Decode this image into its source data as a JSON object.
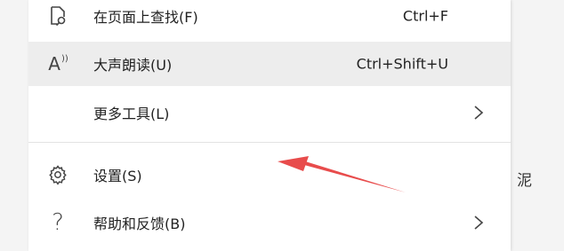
{
  "menu": {
    "items": [
      {
        "label": "在页面上查找(F)",
        "shortcut": "Ctrl+F",
        "icon": "find-on-page-icon"
      },
      {
        "label": "大声朗读(U)",
        "shortcut": "Ctrl+Shift+U",
        "icon": "read-aloud-icon",
        "icon_text": "A",
        "highlighted": true
      },
      {
        "label": "更多工具(L)",
        "icon": "chevron-right-icon",
        "has_submenu": true
      },
      {
        "label": "设置(S)",
        "icon": "gear-icon"
      },
      {
        "label": "帮助和反馈(B)",
        "icon": "question-icon",
        "icon_text": "?",
        "has_submenu": true
      }
    ]
  },
  "annotation": {
    "color": "#e84c4c"
  },
  "side_text": "泥"
}
